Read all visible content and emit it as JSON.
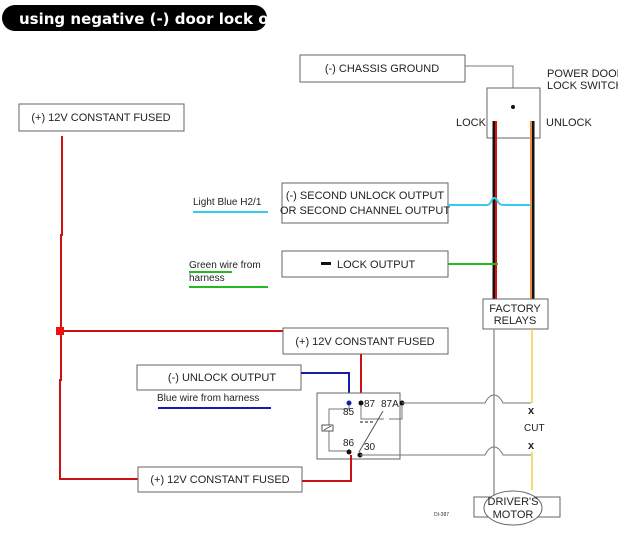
{
  "title": "using negative (-) door lock outputs",
  "boxes": {
    "chassis_ground": "(-) CHASSIS GROUND",
    "constant_fused_top": "(+) 12V CONSTANT FUSED",
    "second_unlock_line1": "(-) SECOND UNLOCK OUTPUT",
    "second_unlock_line2": "OR SECOND CHANNEL OUTPUT",
    "lock_output": "LOCK OUTPUT",
    "constant_fused_mid": "(+) 12V CONSTANT FUSED",
    "unlock_output": "(-) UNLOCK OUTPUT",
    "constant_fused_bottom": "(+) 12V CONSTANT FUSED",
    "factory_relays_line1": "FACTORY",
    "factory_relays_line2": "RELAYS",
    "drivers_motor_line1": "DRIVER'S",
    "drivers_motor_line2": "MOTOR"
  },
  "switch": {
    "title_line1": "POWER DOOR",
    "title_line2": "LOCK SWITCH",
    "lock": "LOCK",
    "unlock": "UNLOCK"
  },
  "wire_labels": {
    "light_blue": "Light Blue H2/1",
    "green_line1": "Green wire from",
    "green_line2": "harness",
    "blue": "Blue wire from harness"
  },
  "relay_pins": {
    "p85": "85",
    "p87": "87",
    "p87a": "87A",
    "p86": "86",
    "p30": "30"
  },
  "cut_label": "CUT",
  "cut_mark": "x",
  "footer_code": "DI-387",
  "colors": {
    "red_wire": "#dd1111",
    "blue_wire": "#1a1aaa",
    "light_blue_wire": "#33ccee",
    "green_wire": "#22bb22",
    "orange_wire": "#ee8844",
    "yellow_wire": "#f0d040",
    "black_wire": "#111111"
  }
}
